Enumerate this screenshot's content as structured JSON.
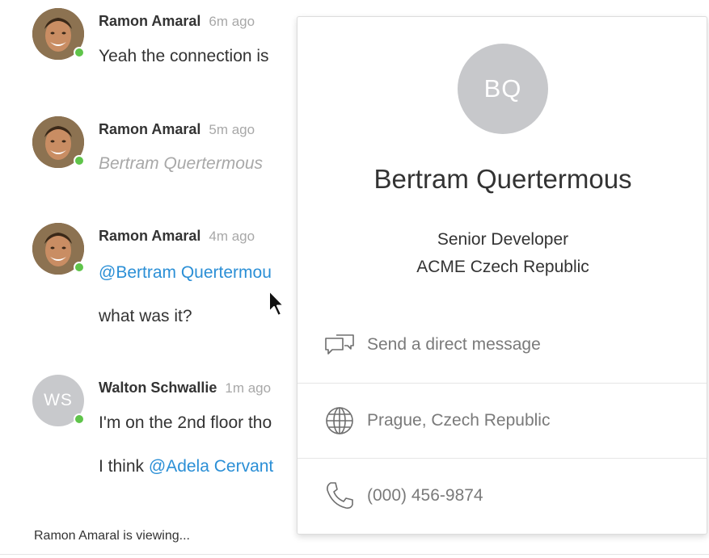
{
  "messages": [
    {
      "author": "Ramon Amaral",
      "time": "6m ago",
      "lines": [
        "Yeah the connection is"
      ]
    },
    {
      "author": "Ramon Amaral",
      "time": "5m ago",
      "lines": [
        "Bertram Quertermous"
      ]
    },
    {
      "author": "Ramon Amaral",
      "time": "4m ago",
      "mention": "@Bertram Quertermou",
      "lines": [
        "what was it?"
      ]
    },
    {
      "author": "Walton Schwallie",
      "initials": "WS",
      "time": "1m ago",
      "lines": [
        "I'm on the 2nd floor tho"
      ],
      "line2_prefix": "I think ",
      "line2_mention": "@Adela Cervant"
    }
  ],
  "status": {
    "viewing": "Ramon Amaral is viewing..."
  },
  "profile_card": {
    "initials": "BQ",
    "name": "Bertram Quertermous",
    "role": "Senior Developer",
    "company": "ACME Czech Republic",
    "actions": {
      "message": "Send a direct message",
      "location": "Prague, Czech Republic",
      "phone": "(000) 456-9874"
    }
  },
  "colors": {
    "online": "#5fc44a",
    "mention": "#2b8fd6",
    "muted": "#a8a8a8"
  },
  "icons": [
    "chat-bubbles-icon",
    "globe-icon",
    "phone-icon",
    "cursor-arrow-icon"
  ]
}
